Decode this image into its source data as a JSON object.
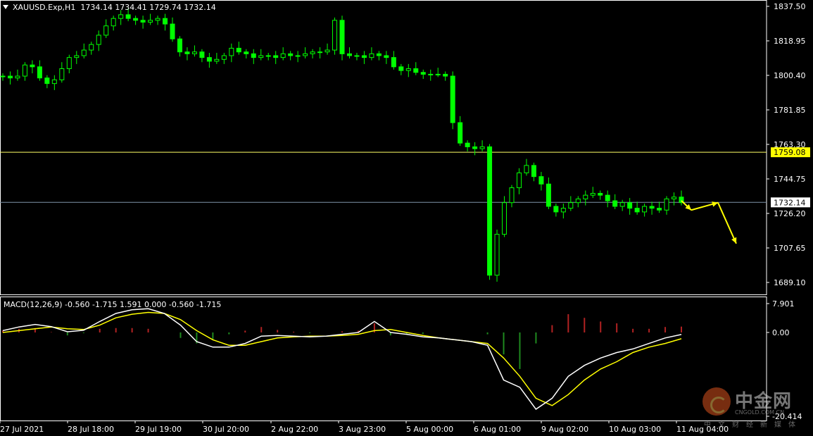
{
  "main_header": {
    "symbol": "XAUUSD.Exp,H1",
    "ohlc": "1734.14 1734.41 1729.74 1732.14"
  },
  "macd_header": {
    "text": "MACD(12,26,9) -0.560 -1.715 1.591 0.000 -0.560 -1.715"
  },
  "watermark": {
    "cn": "中金网",
    "en": "CNGOLD.COM.CN",
    "sub": "中文财经新媒体"
  },
  "chart_data": [
    {
      "type": "candlestick",
      "symbol": "XAUUSD.Exp",
      "timeframe": "H1",
      "y_ticks": [
        "1837.50",
        "1818.95",
        "1800.40",
        "1781.85",
        "1763.30",
        "1744.75",
        "1726.20",
        "1707.65",
        "1689.10"
      ],
      "ylim": [
        1685,
        1840
      ],
      "x_ticks": [
        "27 Jul 2021",
        "28 Jul 18:00",
        "29 Jul 19:00",
        "30 Jul 20:00",
        "2 Aug 22:00",
        "3 Aug 23:00",
        "5 Aug 00:00",
        "6 Aug 01:00",
        "9 Aug 02:00",
        "10 Aug 03:00",
        "11 Aug 04:00"
      ],
      "horizontal_lines": [
        {
          "value": 1759.08,
          "label": "1759.08",
          "color": "#ffff66",
          "label_bg": "#ffff00",
          "label_color": "#000000"
        },
        {
          "value": 1732.14,
          "label": "1732.14",
          "color": "#7f93a8",
          "label_bg": "#ffffff",
          "label_color": "#000000"
        }
      ],
      "close_path": [
        1800,
        1799,
        1800,
        1806,
        1805,
        1799,
        1796,
        1798,
        1804,
        1810,
        1811,
        1814,
        1817,
        1822,
        1827,
        1831,
        1833,
        1831,
        1830,
        1829,
        1830,
        1831,
        1828,
        1820,
        1813,
        1812,
        1813,
        1810,
        1808,
        1809,
        1811,
        1815,
        1813,
        1812,
        1810,
        1811,
        1811,
        1810,
        1812,
        1811,
        1811,
        1812,
        1813,
        1813,
        1814,
        1830,
        1812,
        1811,
        1811,
        1810,
        1812,
        1811,
        1810,
        1805,
        1803,
        1804,
        1802,
        1801,
        1801,
        1801,
        1800,
        1775,
        1764,
        1762,
        1761,
        1762,
        1693,
        1715,
        1732,
        1740,
        1748,
        1752,
        1746,
        1742,
        1730,
        1727,
        1729,
        1732,
        1734,
        1736,
        1737,
        1736,
        1733,
        1730,
        1732,
        1729,
        1727,
        1730,
        1729,
        1728,
        1734,
        1735,
        1732
      ],
      "projection": [
        1733,
        1728,
        1732,
        1710
      ],
      "colors": {
        "up": "#00ff00",
        "down": "#00ff00",
        "projection": "#ffff00"
      }
    },
    {
      "type": "macd",
      "label": "MACD(12,26,9)",
      "values_shown": [
        -0.56,
        -1.715,
        1.591,
        0.0,
        -0.56,
        -1.715
      ],
      "y_ticks": [
        "7.901",
        "0.00",
        "-20.414"
      ],
      "ylim": [
        -22,
        9
      ],
      "macd_line": [
        0.5,
        1.5,
        2.2,
        1.6,
        0.2,
        0.6,
        3.0,
        5.2,
        6.2,
        6.5,
        5.2,
        2.0,
        -2.5,
        -4.0,
        -4.0,
        -3.0,
        -1.0,
        -0.8,
        -1.0,
        -1.2,
        -1.0,
        -0.5,
        0.0,
        3.0,
        0.0,
        -0.5,
        -1.2,
        -1.5,
        -2.0,
        -2.5,
        -3.5,
        -13.0,
        -15.0,
        -21.0,
        -18.0,
        -12.0,
        -9.0,
        -7.0,
        -5.5,
        -4.5,
        -3.0,
        -1.5,
        -0.56
      ],
      "signal_line": [
        0.0,
        0.5,
        1.0,
        1.5,
        1.0,
        0.8,
        2.0,
        4.0,
        5.0,
        5.5,
        5.2,
        3.5,
        0.5,
        -2.0,
        -3.5,
        -3.5,
        -2.5,
        -1.5,
        -1.2,
        -1.0,
        -1.0,
        -0.8,
        -0.5,
        0.5,
        0.8,
        0.0,
        -0.8,
        -1.5,
        -2.0,
        -2.5,
        -3.0,
        -7.0,
        -12.0,
        -18.0,
        -20.0,
        -17.0,
        -13.0,
        -10.0,
        -8.0,
        -5.5,
        -4.0,
        -3.0,
        -1.715
      ],
      "histogram": [
        0.5,
        1.0,
        1.2,
        0.1,
        -0.8,
        -0.2,
        1.0,
        1.2,
        1.2,
        1.0,
        0.0,
        -1.5,
        -3.0,
        -2.0,
        -0.5,
        0.5,
        1.5,
        0.7,
        0.2,
        -0.2,
        0.0,
        0.3,
        0.5,
        2.5,
        -0.8,
        -0.5,
        -0.4,
        0.0,
        0.0,
        0.0,
        -0.5,
        -6.0,
        -10.0,
        -3.0,
        2.0,
        5.0,
        4.0,
        3.0,
        2.5,
        1.0,
        1.0,
        1.5,
        1.6
      ],
      "colors": {
        "macd": "#ffffff",
        "signal": "#ffff00",
        "hist_pos": "#b22222",
        "hist_neg": "#1f8a1f"
      }
    }
  ]
}
